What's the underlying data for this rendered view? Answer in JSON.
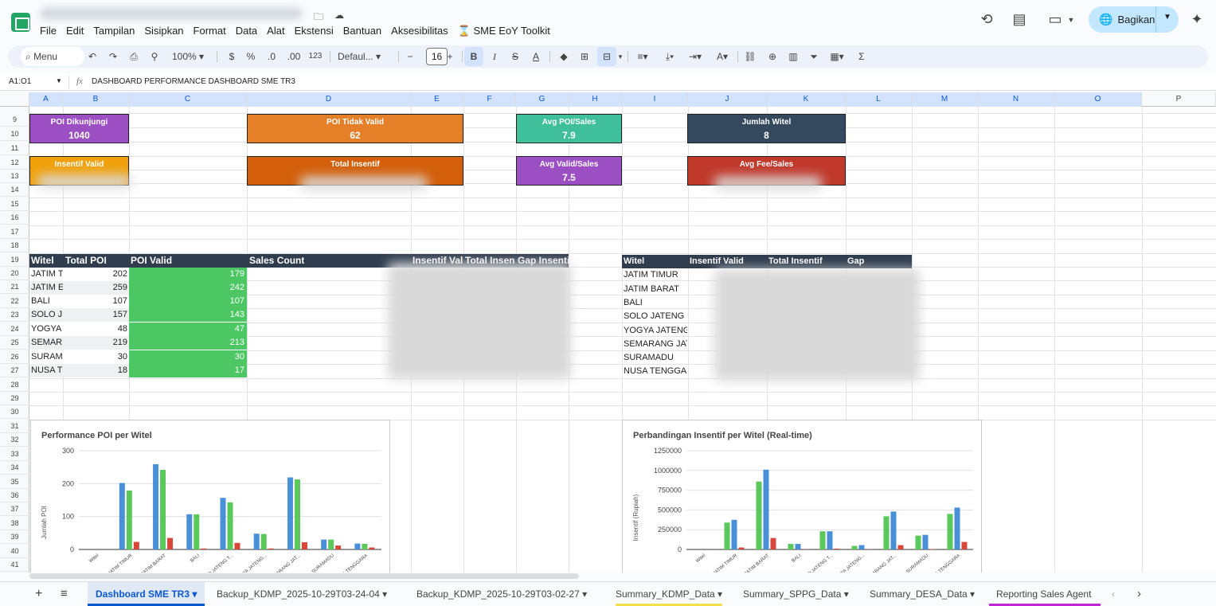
{
  "menu": [
    "File",
    "Edit",
    "Tampilan",
    "Sisipkan",
    "Format",
    "Data",
    "Alat",
    "Ekstensi",
    "Bantuan",
    "Aksesibilitas",
    "SME EoY Toolkit"
  ],
  "share_label": "Bagikan",
  "toolbar": {
    "search": "Menu",
    "zoom": "100%",
    "currency": "$",
    "percent": "%",
    "dec_dec": ".0",
    "inc_dec": ".00",
    "num_format": "123",
    "font": "Defaul...",
    "font_size": "16",
    "minus": "−",
    "plus": "+",
    "bold": "B",
    "italic": "I",
    "strike": "S",
    "textcolor": "A",
    "sum": "Σ"
  },
  "formula_bar": {
    "cell_ref": "A1:O1",
    "fx": "fx",
    "content": "DASHBOARD PERFORMANCE DASHBOARD SME TR3"
  },
  "columns": [
    "A",
    "B",
    "C",
    "D",
    "E",
    "F",
    "G",
    "H",
    "I",
    "J",
    "K",
    "L",
    "M",
    "N",
    "O",
    "P"
  ],
  "rows": [
    "9",
    "10",
    "11",
    "12",
    "13",
    "14",
    "15",
    "16",
    "17",
    "18",
    "19",
    "20",
    "21",
    "22",
    "23",
    "24",
    "25",
    "26",
    "27",
    "28",
    "29",
    "30",
    "31",
    "32",
    "33",
    "34",
    "35",
    "36",
    "37",
    "38",
    "39",
    "40",
    "41"
  ],
  "kpis": [
    {
      "label": "POI Dikunjungi",
      "value": "1040",
      "color": "#9b4fc2"
    },
    {
      "label": "POI Tidak Valid",
      "value": "62",
      "color": "#e57f28"
    },
    {
      "label": "Avg POI/Sales",
      "value": "7.9",
      "color": "#3fbf9a"
    },
    {
      "label": "Jumlah Witel",
      "value": "8",
      "color": "#34495e"
    },
    {
      "label": "Insentif Valid",
      "value": "",
      "color": "#f0a10a"
    },
    {
      "label": "Total Insentif",
      "value": "",
      "color": "#d35f0a"
    },
    {
      "label": "Avg Valid/Sales",
      "value": "7.5",
      "color": "#9b4fc2"
    },
    {
      "label": "Avg Fee/Sales",
      "value": "",
      "color": "#c0392b"
    }
  ],
  "table1": {
    "headers": [
      "Witel",
      "Total POI",
      "POI Valid",
      "Sales Count",
      "Insentif Val",
      "Total Insen",
      "Gap Insenti"
    ],
    "rows": [
      {
        "witel": "JATIM T",
        "total": "202",
        "valid": "179"
      },
      {
        "witel": "JATIM E",
        "total": "259",
        "valid": "242"
      },
      {
        "witel": "BALI",
        "total": "107",
        "valid": "107"
      },
      {
        "witel": "SOLO J",
        "total": "157",
        "valid": "143"
      },
      {
        "witel": "YOGYA",
        "total": "48",
        "valid": "47"
      },
      {
        "witel": "SEMAR",
        "total": "219",
        "valid": "213"
      },
      {
        "witel": "SURAM",
        "total": "30",
        "valid": "30"
      },
      {
        "witel": "NUSA T",
        "total": "18",
        "valid": "17"
      }
    ]
  },
  "table2": {
    "headers": [
      "Witel",
      "Insentif Valid",
      "Total Insentif",
      "Gap"
    ],
    "rows": [
      "JATIM TIMUR",
      "JATIM BARAT",
      "BALI",
      "SOLO JATENG",
      "YOGYA JATENG",
      "SEMARANG JAT",
      "SURAMADU",
      "NUSA TENGGA"
    ]
  },
  "colors": {
    "valid_green": "#4cc764",
    "series_blue": "#4a90d9",
    "series_green": "#5ac85a",
    "series_red": "#d9473b",
    "header_dark": "#2f3d4f"
  },
  "chart_data": [
    {
      "type": "bar",
      "title": "Performance POI per Witel",
      "ylabel": "Jumlah POI",
      "ylim": [
        0,
        300
      ],
      "yticks": [
        "300",
        "200",
        "100",
        "0"
      ],
      "categories": [
        "Witel",
        "JATIM TIMUR",
        "JATIM BARAT",
        "BALI",
        "SOLO JATENG T...",
        "YOGYA JATENG...",
        "SEMARANG JAT...",
        "SURAMADU",
        "NUSA TENGGARA"
      ],
      "series": [
        {
          "values": [
            0,
            202,
            259,
            107,
            157,
            48,
            219,
            30,
            18
          ]
        },
        {
          "values": [
            0,
            179,
            242,
            107,
            143,
            47,
            213,
            30,
            17
          ]
        },
        {
          "values": [
            0,
            23,
            35,
            3,
            20,
            3,
            22,
            12,
            6
          ]
        }
      ]
    },
    {
      "type": "bar",
      "title": "Perbandingan Insentif per Witel (Real-time)",
      "ylabel": "Insentif (Rupiah)",
      "ylim": [
        0,
        1250000
      ],
      "yticks": [
        "1250000",
        "1000000",
        "750000",
        "500000",
        "250000",
        "0"
      ],
      "categories": [
        "Witel",
        "JATIM TIMUR",
        "JATIM BARAT",
        "BALI",
        "SOLO JATENG T...",
        "YOGYA JATENG...",
        "SEMARANG JAT...",
        "SURAMADU",
        "NUSA TENGGARA"
      ],
      "series": [
        {
          "values": [
            0,
            340000,
            860000,
            70000,
            230000,
            45000,
            420000,
            175000,
            450000
          ]
        },
        {
          "values": [
            0,
            375000,
            1010000,
            70000,
            230000,
            55000,
            480000,
            185000,
            530000
          ]
        },
        {
          "values": [
            0,
            25000,
            145000,
            3000,
            10000,
            3000,
            55000,
            5000,
            95000
          ]
        }
      ]
    }
  ],
  "sheet_tabs": [
    "Dashboard SME TR3",
    "Backup_KDMP_2025-10-29T03-24-04",
    "Backup_KDMP_2025-10-29T03-02-27",
    "Summary_KDMP_Data",
    "Summary_SPPG_Data",
    "Summary_DESA_Data",
    "Reporting Sales Agent"
  ]
}
